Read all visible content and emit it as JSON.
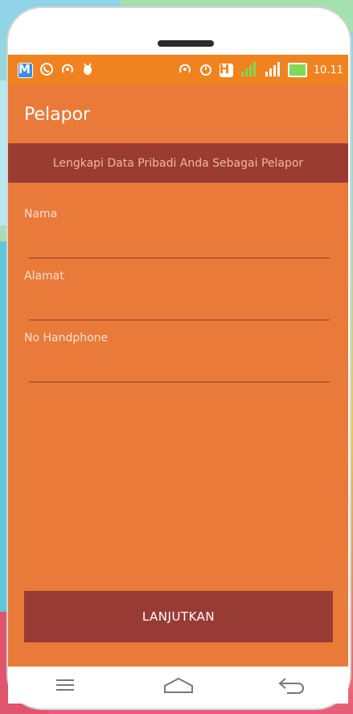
{
  "status_bar": {
    "time": "10.11",
    "icons": [
      "messenger-icon",
      "whatsapp-icon",
      "hotspot-icon",
      "android-debug-icon",
      "hotspot-icon",
      "alarm-icon",
      "h-network-icon",
      "signal-icon",
      "signal-icon",
      "battery-charging-icon"
    ],
    "h_badge": "H",
    "m_badge": "M"
  },
  "app_bar": {
    "title": "Pelapor"
  },
  "banner": {
    "text": "Lengkapi Data Pribadi Anda Sebagai Pelapor"
  },
  "form": {
    "fields": [
      {
        "label": "Nama",
        "value": ""
      },
      {
        "label": "Alamat",
        "value": ""
      },
      {
        "label": "No Handphone",
        "value": ""
      }
    ]
  },
  "continue_button": {
    "label": "LANJUTKAN"
  },
  "colors": {
    "status_bar": "#f0831f",
    "app_bar": "#ea7a3a",
    "banner": "#9a3c32",
    "button": "#993b35"
  },
  "nav_bar": {
    "icons": [
      "menu-icon",
      "home-icon",
      "back-icon"
    ]
  }
}
